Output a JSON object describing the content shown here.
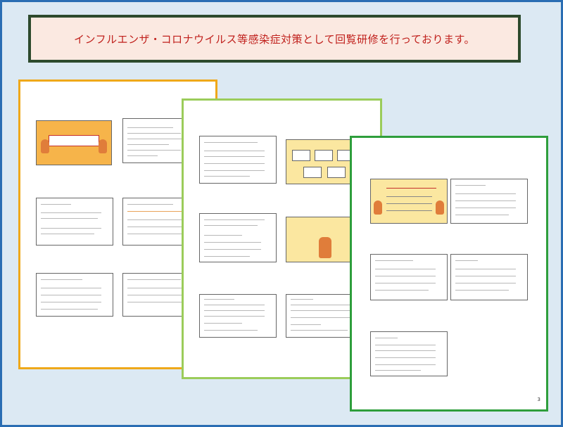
{
  "banner": {
    "text": "インフルエンザ・コロナウイルス等感染症対策として回覧研修を行っております。"
  },
  "page3": {
    "page_number": "3"
  }
}
